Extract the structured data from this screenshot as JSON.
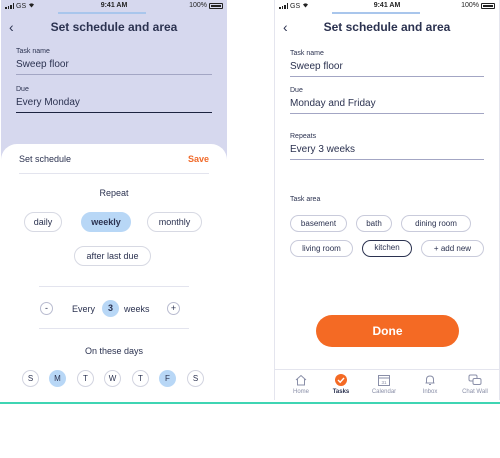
{
  "status_bar": {
    "carrier": "GS",
    "time": "9:41 AM",
    "battery": "100%"
  },
  "colors": {
    "accent_orange": "#f46a24",
    "selected_blue": "#b8d7f6",
    "teal_line": "#3fd5b3",
    "overlay": "#d6d8ee",
    "text": "#2b3250"
  },
  "left": {
    "title": "Set schedule and area",
    "task_name_label": "Task name",
    "task_name_value": "Sweep floor",
    "due_label": "Due",
    "due_value": "Every Monday",
    "sheet": {
      "title": "Set schedule",
      "save": "Save",
      "repeat_label": "Repeat",
      "repeat_options": [
        "daily",
        "weekly",
        "monthly",
        "after last due"
      ],
      "selected_repeat": "weekly",
      "minus": "-",
      "plus": "+",
      "every_label": "Every",
      "every_count": "3",
      "every_unit": "weeks",
      "days_label": "On these days",
      "days": [
        "S",
        "M",
        "T",
        "W",
        "T",
        "F",
        "S"
      ],
      "selected_days": [
        "M",
        "F"
      ]
    }
  },
  "right": {
    "title": "Set schedule and area",
    "task_name_label": "Task name",
    "task_name_value": "Sweep floor",
    "due_label": "Due",
    "due_value": "Monday and Friday",
    "repeats_label": "Repeats",
    "repeats_value": "Every 3 weeks",
    "task_area_label": "Task area",
    "areas": [
      "basement",
      "bath",
      "dining room",
      "living room",
      "kitchen",
      "add new"
    ],
    "selected_area": "kitchen",
    "done_label": "Done",
    "tabs": [
      "Home",
      "Tasks",
      "Calendar",
      "Inbox",
      "Chat Wall"
    ],
    "active_tab": "Tasks",
    "calendar_day": "31"
  },
  "progress_fraction": 0.93
}
